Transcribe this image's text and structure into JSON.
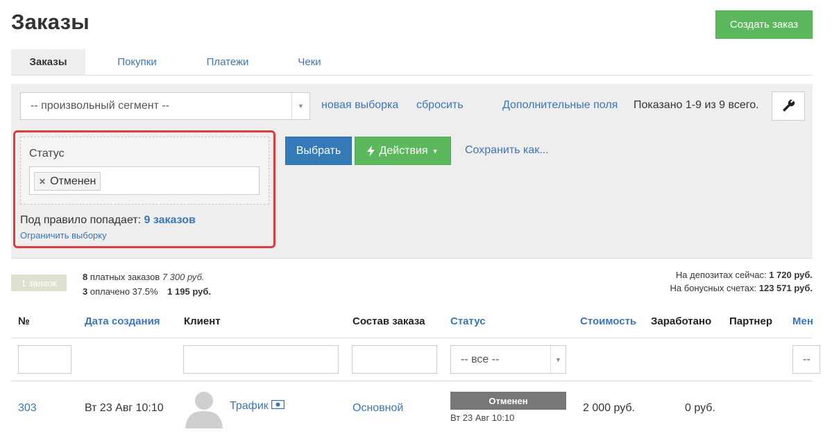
{
  "header": {
    "title": "Заказы",
    "create_button": "Создать заказ"
  },
  "tabs": [
    {
      "label": "Заказы",
      "active": true
    },
    {
      "label": "Покупки",
      "active": false
    },
    {
      "label": "Платежи",
      "active": false
    },
    {
      "label": "Чеки",
      "active": false
    }
  ],
  "filter": {
    "segment_value": "-- произвольный сегмент --",
    "new_selection": "новая выборка",
    "reset": "сбросить",
    "extra_fields": "Дополнительные поля",
    "shown_text": "Показано 1-9 из 9 всего.",
    "status_label": "Статус",
    "status_chip": "Отменен",
    "rule_prefix": "Под правило попадает:",
    "rule_count": "9 заказов",
    "limit_link": "Ограничить выборку",
    "select_button": "Выбрать",
    "actions_button": "Действия",
    "save_link": "Сохранить как..."
  },
  "stats": {
    "badge": "1 заявок",
    "paid_count": "8",
    "paid_label": "платных заказов",
    "paid_amount": "7 300 руб.",
    "payed_count": "3",
    "payed_label": "оплачено 37.5%",
    "payed_amount": "1 195 руб.",
    "deposit_label": "На депозитах сейчас:",
    "deposit_value": "1 720 руб.",
    "bonus_label": "На бонусных счетах:",
    "bonus_value": "123 571 руб."
  },
  "table": {
    "columns": {
      "num": "№",
      "date": "Дата создания",
      "client": "Клиент",
      "composition": "Состав заказа",
      "status": "Статус",
      "cost": "Стоимость",
      "earned": "Заработано",
      "partner": "Партнер",
      "manager": "Мен"
    },
    "status_filter": "-- все --",
    "manager_filter": "--",
    "rows": [
      {
        "num": "303",
        "date": "Вт 23 Авг 10:10",
        "client": "Трафик",
        "composition": "Основной",
        "status": "Отменен",
        "status_date": "Вт 23 Авг 10:10",
        "cost": "2 000 руб.",
        "earned": "0 руб."
      }
    ]
  },
  "colors": {
    "link": "#3a76b8",
    "success": "#5cb85c",
    "primary": "#337ab7",
    "highlight": "#e03a3a",
    "status_badge": "#777777"
  }
}
